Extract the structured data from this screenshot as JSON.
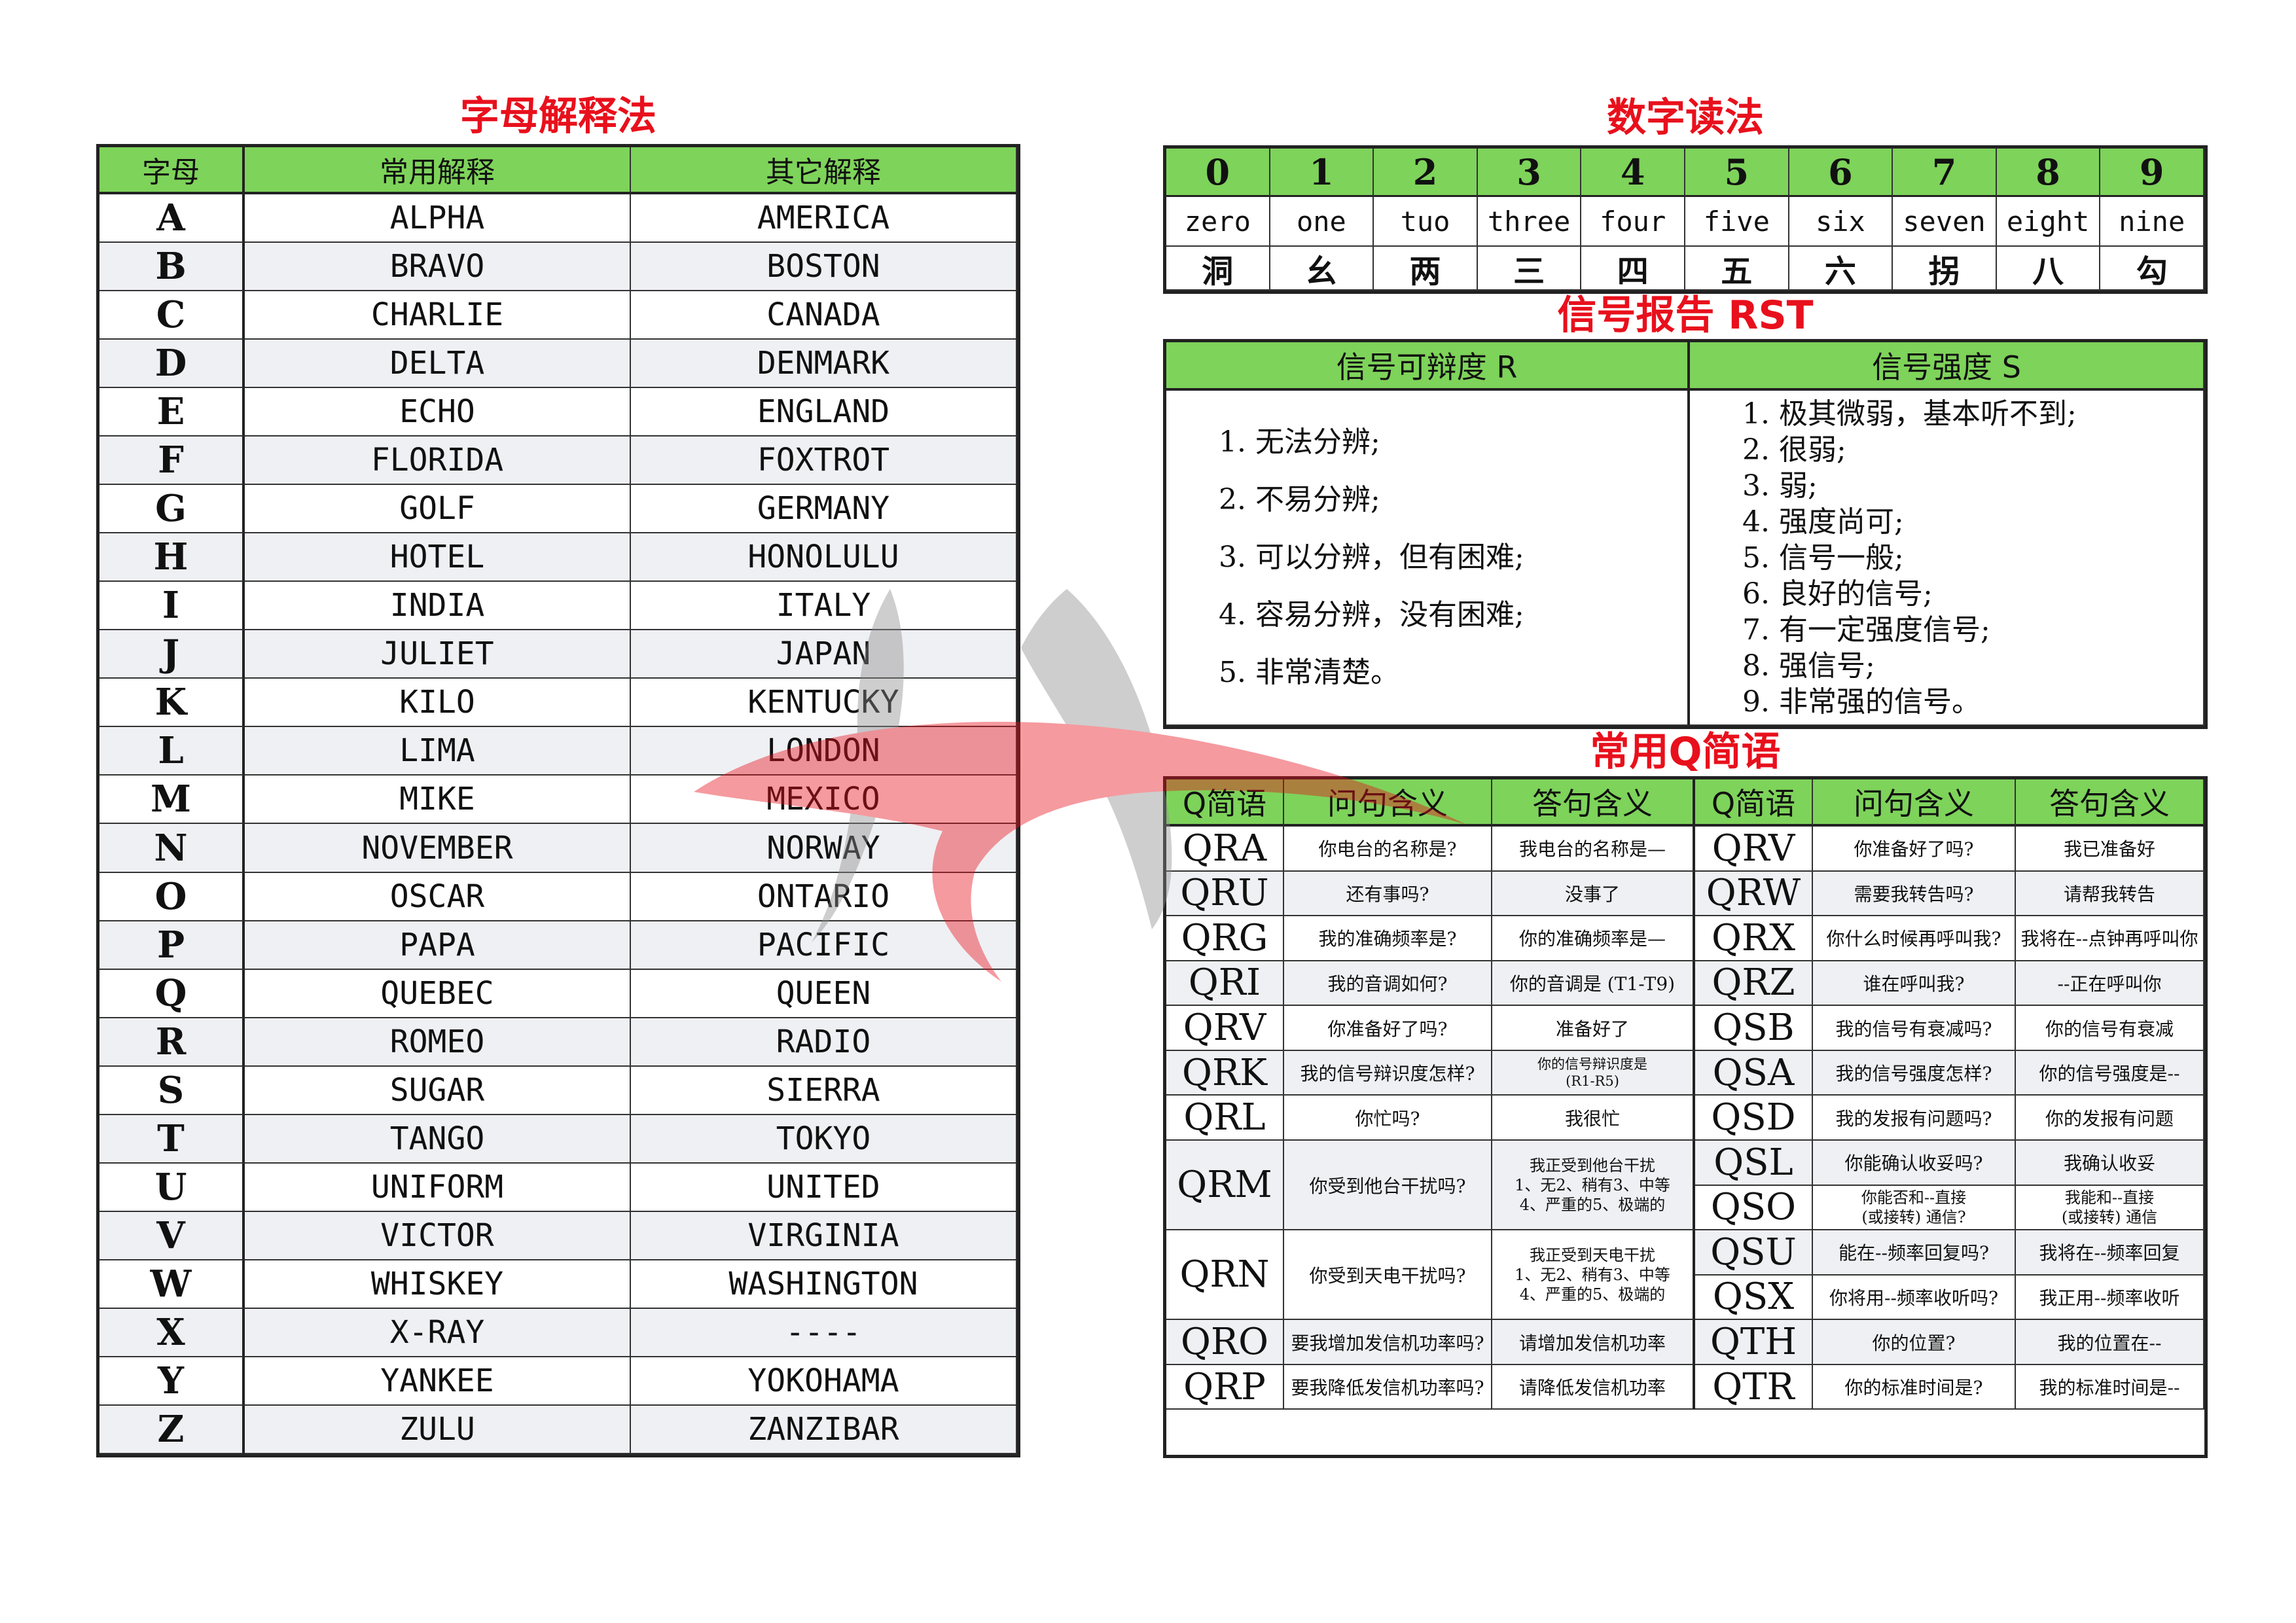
{
  "alphabet": {
    "title": "字母解释法",
    "headers": [
      "字母",
      "常用解释",
      "其它解释"
    ],
    "rows": [
      [
        "A",
        "ALPHA",
        "AMERICA"
      ],
      [
        "B",
        "BRAVO",
        "BOSTON"
      ],
      [
        "C",
        "CHARLIE",
        "CANADA"
      ],
      [
        "D",
        "DELTA",
        "DENMARK"
      ],
      [
        "E",
        "ECHO",
        "ENGLAND"
      ],
      [
        "F",
        "FLORIDA",
        "FOXTROT"
      ],
      [
        "G",
        "GOLF",
        "GERMANY"
      ],
      [
        "H",
        "HOTEL",
        "HONOLULU"
      ],
      [
        "I",
        "INDIA",
        "ITALY"
      ],
      [
        "J",
        "JULIET",
        "JAPAN"
      ],
      [
        "K",
        "KILO",
        "KENTUCKY"
      ],
      [
        "L",
        "LIMA",
        "LONDON"
      ],
      [
        "M",
        "MIKE",
        "MEXICO"
      ],
      [
        "N",
        "NOVEMBER",
        "NORWAY"
      ],
      [
        "O",
        "OSCAR",
        "ONTARIO"
      ],
      [
        "P",
        "PAPA",
        "PACIFIC"
      ],
      [
        "Q",
        "QUEBEC",
        "QUEEN"
      ],
      [
        "R",
        "ROMEO",
        "RADIO"
      ],
      [
        "S",
        "SUGAR",
        "SIERRA"
      ],
      [
        "T",
        "TANGO",
        "TOKYO"
      ],
      [
        "U",
        "UNIFORM",
        "UNITED"
      ],
      [
        "V",
        "VICTOR",
        "VIRGINIA"
      ],
      [
        "W",
        "WHISKEY",
        "WASHINGTON"
      ],
      [
        "X",
        "X-RAY",
        "----"
      ],
      [
        "Y",
        "YANKEE",
        "YOKOHAMA"
      ],
      [
        "Z",
        "ZULU",
        "ZANZIBAR"
      ]
    ]
  },
  "numbers": {
    "title": "数字读法",
    "digits": [
      "0",
      "1",
      "2",
      "3",
      "4",
      "5",
      "6",
      "7",
      "8",
      "9"
    ],
    "english": [
      "zero",
      "one",
      "tuo",
      "three",
      "four",
      "five",
      "six",
      "seven",
      "eight",
      "nine"
    ],
    "chinese": [
      "洞",
      "幺",
      "两",
      "三",
      "四",
      "五",
      "六",
      "拐",
      "八",
      "勾"
    ]
  },
  "rst": {
    "title": "信号报告 RST",
    "headers": [
      "信号可辩度 R",
      "信号强度 S"
    ],
    "readability": [
      "1. 无法分辨;",
      "2. 不易分辨;",
      "3. 可以分辨，但有困难;",
      "4. 容易分辨，没有困难;",
      "5. 非常清楚。"
    ],
    "strength": [
      "1. 极其微弱，基本听不到;",
      "2. 很弱;",
      "3. 弱;",
      "4. 强度尚可;",
      "5. 信号一般;",
      "6. 良好的信号;",
      "7. 有一定强度信号;",
      "8. 强信号;",
      "9. 非常强的信号。"
    ]
  },
  "qcodes": {
    "title": "常用Q简语",
    "headers": [
      "Q简语",
      "问句含义",
      "答句含义",
      "Q简语",
      "问句含义",
      "答句含义"
    ],
    "left": [
      {
        "code": "QRA",
        "q": "你电台的名称是?",
        "a": "我电台的名称是—"
      },
      {
        "code": "QRU",
        "q": "还有事吗?",
        "a": "没事了"
      },
      {
        "code": "QRG",
        "q": "我的准确频率是?",
        "a": "你的准确频率是—"
      },
      {
        "code": "QRI",
        "q": "我的音调如何?",
        "a": "你的音调是 (T1-T9)"
      },
      {
        "code": "QRV",
        "q": "你准备好了吗?",
        "a": "准备好了"
      },
      {
        "code": "QRK",
        "q": "我的信号辩识度怎样?",
        "a1": "你的信号辩识度是",
        "a2": "(R1-R5)"
      },
      {
        "code": "QRL",
        "q": "你忙吗?",
        "a": "我很忙"
      },
      {
        "code": "QRM",
        "q": "你受到他台干扰吗?",
        "a1": "我正受到他台干扰",
        "a2": "1、无2、稍有3、中等",
        "a3": "4、严重的5、极端的"
      },
      {
        "code": "QRN",
        "q": "你受到天电干扰吗?",
        "a1": "我正受到天电干扰",
        "a2": "1、无2、稍有3、中等",
        "a3": "4、严重的5、极端的"
      },
      {
        "code": "QRO",
        "q": "要我增加发信机功率吗?",
        "a": "请增加发信机功率"
      },
      {
        "code": "QRP",
        "q": "要我降低发信机功率吗?",
        "a": "请降低发信机功率"
      }
    ],
    "right": [
      {
        "code": "QRV",
        "q": "你准备好了吗?",
        "a": "我已准备好"
      },
      {
        "code": "QRW",
        "q": "需要我转告吗?",
        "a": "请帮我转告"
      },
      {
        "code": "QRX",
        "q": "你什么时候再呼叫我?",
        "a": "我将在--点钟再呼叫你"
      },
      {
        "code": "QRZ",
        "q": "谁在呼叫我?",
        "a": "--正在呼叫你"
      },
      {
        "code": "QSB",
        "q": "我的信号有衰减吗?",
        "a": "你的信号有衰减"
      },
      {
        "code": "QSA",
        "q": "我的信号强度怎样?",
        "a": "你的信号强度是--"
      },
      {
        "code": "QSD",
        "q": "我的发报有问题吗?",
        "a": "你的发报有问题"
      },
      {
        "code": "QSL",
        "q": "你能确认收妥吗?",
        "a": "我确认收妥"
      },
      {
        "code": "QSO",
        "q1": "你能否和--直接",
        "q2": "(或接转) 通信?",
        "a1": "我能和--直接",
        "a2": "(或接转) 通信"
      },
      {
        "code": "QSU",
        "q": "能在--频率回复吗?",
        "a": "我将在--频率回复"
      },
      {
        "code": "QSX",
        "q": "你将用--频率收听吗?",
        "a": "我正用--频率收听"
      },
      {
        "code": "QTH",
        "q": "你的位置?",
        "a": "我的位置在--"
      },
      {
        "code": "QTR",
        "q": "你的标准时间是?",
        "a": "我的标准时间是--"
      }
    ]
  },
  "colors": {
    "title": "#e8101c",
    "header": "#7ed35a",
    "row_alt": "#eff0f4",
    "logo_red": "#e8101c",
    "logo_gray": "#8c8c8c"
  }
}
